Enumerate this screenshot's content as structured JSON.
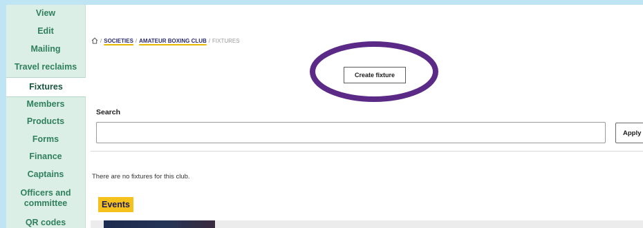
{
  "sidebar": {
    "items": [
      {
        "label": "View"
      },
      {
        "label": "Edit"
      },
      {
        "label": "Mailing"
      },
      {
        "label": "Travel reclaims"
      },
      {
        "label": "Fixtures"
      },
      {
        "label": "Members"
      },
      {
        "label": "Products"
      },
      {
        "label": "Forms"
      },
      {
        "label": "Finance"
      },
      {
        "label": "Captains"
      },
      {
        "label": "Officers and committee"
      },
      {
        "label": "QR codes"
      }
    ],
    "active": "Fixtures"
  },
  "breadcrumb": {
    "home_icon": "home-icon",
    "sep": "/",
    "societies": "SOCIETIES",
    "club": "AMATEUR BOXING CLUB",
    "current": "FIXTURES"
  },
  "main": {
    "create_button": "Create fixture",
    "search_label": "Search",
    "search_value": "",
    "apply_button": "Apply",
    "empty_message": "There are no fixtures for this club.",
    "events_heading": "Events"
  },
  "colors": {
    "sidebar_bg": "#dcefe6",
    "sidebar_text": "#2f7f5d",
    "accent_yellow": "#f4c11d",
    "highlight_ring": "#5b2a86",
    "frame": "#bfe4f4"
  }
}
